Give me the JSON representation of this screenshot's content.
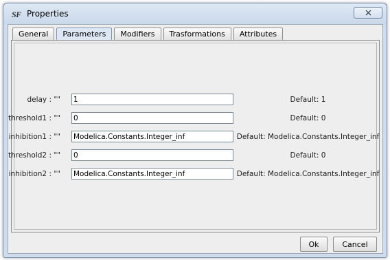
{
  "window": {
    "app_logo": "SF",
    "title": "Properties",
    "close_icon": "close-x-icon"
  },
  "tabs": [
    {
      "label": "General",
      "active": false
    },
    {
      "label": "Parameters",
      "active": true
    },
    {
      "label": "Modifiers",
      "active": false
    },
    {
      "label": "Trasformations",
      "active": false
    },
    {
      "label": "Attributes",
      "active": false
    }
  ],
  "parameters": [
    {
      "label": "delay : \"\"",
      "value": "1",
      "default": "Default: 1"
    },
    {
      "label": "threshold1 : \"\"",
      "value": "0",
      "default": "Default: 0"
    },
    {
      "label": "inhibition1 : \"\"",
      "value": "Modelica.Constants.Integer_inf",
      "default": "Default: Modelica.Constants.Integer_inf"
    },
    {
      "label": "threshold2 : \"\"",
      "value": "0",
      "default": "Default: 0"
    },
    {
      "label": "inhibition2 : \"\"",
      "value": "Modelica.Constants.Integer_inf",
      "default": "Default: Modelica.Constants.Integer_inf"
    }
  ],
  "buttons": {
    "ok_label": "Ok",
    "cancel_label": "Cancel"
  }
}
